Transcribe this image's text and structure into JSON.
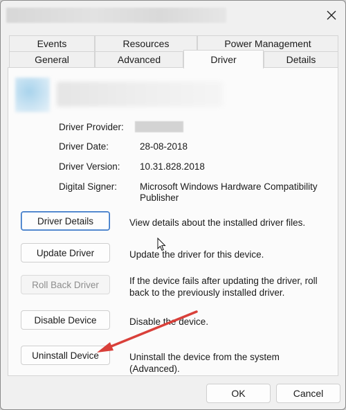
{
  "tabs_row1": [
    "Events",
    "Resources",
    "Power Management"
  ],
  "tabs_row2": [
    "General",
    "Advanced",
    "Driver",
    "Details"
  ],
  "active_tab": "Driver",
  "info": {
    "provider_label": "Driver Provider:",
    "date_label": "Driver Date:",
    "date_value": "28-08-2018",
    "version_label": "Driver Version:",
    "version_value": "10.31.828.2018",
    "signer_label": "Digital Signer:",
    "signer_value": "Microsoft Windows Hardware Compatibility Publisher"
  },
  "actions": [
    {
      "label": "Driver Details",
      "description": "View details about the installed driver files."
    },
    {
      "label": "Update Driver",
      "description": "Update the driver for this device."
    },
    {
      "label": "Roll Back Driver",
      "description": "If the device fails after updating the driver, roll back to the previously installed driver."
    },
    {
      "label": "Disable Device",
      "description": "Disable the device."
    },
    {
      "label": "Uninstall Device",
      "description": "Uninstall the device from the system (Advanced)."
    }
  ],
  "footer": {
    "ok": "OK",
    "cancel": "Cancel"
  },
  "icons": {
    "close": "close-icon",
    "cursor": "mouse-pointer-icon",
    "annotation": "red-arrow-icon"
  },
  "colors": {
    "focus": "#2f6fc4",
    "arrow": "#d9403a",
    "panel": "#fbfbfb",
    "dialog": "#f0f0f0"
  }
}
